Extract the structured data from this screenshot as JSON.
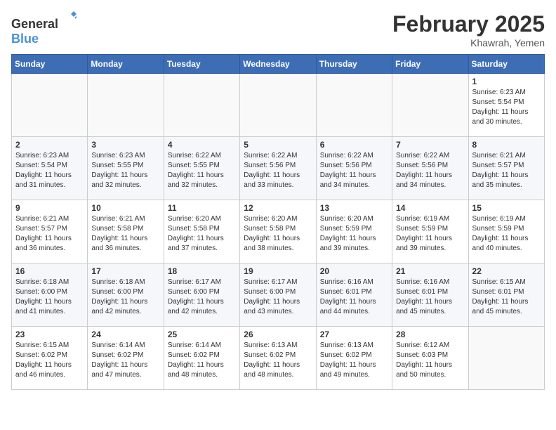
{
  "logo": {
    "text_general": "General",
    "text_blue": "Blue"
  },
  "title": "February 2025",
  "subtitle": "Khawrah, Yemen",
  "days_of_week": [
    "Sunday",
    "Monday",
    "Tuesday",
    "Wednesday",
    "Thursday",
    "Friday",
    "Saturday"
  ],
  "weeks": [
    [
      {
        "day": "",
        "info": ""
      },
      {
        "day": "",
        "info": ""
      },
      {
        "day": "",
        "info": ""
      },
      {
        "day": "",
        "info": ""
      },
      {
        "day": "",
        "info": ""
      },
      {
        "day": "",
        "info": ""
      },
      {
        "day": "1",
        "info": "Sunrise: 6:23 AM\nSunset: 5:54 PM\nDaylight: 11 hours and 30 minutes."
      }
    ],
    [
      {
        "day": "2",
        "info": "Sunrise: 6:23 AM\nSunset: 5:54 PM\nDaylight: 11 hours and 31 minutes."
      },
      {
        "day": "3",
        "info": "Sunrise: 6:23 AM\nSunset: 5:55 PM\nDaylight: 11 hours and 32 minutes."
      },
      {
        "day": "4",
        "info": "Sunrise: 6:22 AM\nSunset: 5:55 PM\nDaylight: 11 hours and 32 minutes."
      },
      {
        "day": "5",
        "info": "Sunrise: 6:22 AM\nSunset: 5:56 PM\nDaylight: 11 hours and 33 minutes."
      },
      {
        "day": "6",
        "info": "Sunrise: 6:22 AM\nSunset: 5:56 PM\nDaylight: 11 hours and 34 minutes."
      },
      {
        "day": "7",
        "info": "Sunrise: 6:22 AM\nSunset: 5:56 PM\nDaylight: 11 hours and 34 minutes."
      },
      {
        "day": "8",
        "info": "Sunrise: 6:21 AM\nSunset: 5:57 PM\nDaylight: 11 hours and 35 minutes."
      }
    ],
    [
      {
        "day": "9",
        "info": "Sunrise: 6:21 AM\nSunset: 5:57 PM\nDaylight: 11 hours and 36 minutes."
      },
      {
        "day": "10",
        "info": "Sunrise: 6:21 AM\nSunset: 5:58 PM\nDaylight: 11 hours and 36 minutes."
      },
      {
        "day": "11",
        "info": "Sunrise: 6:20 AM\nSunset: 5:58 PM\nDaylight: 11 hours and 37 minutes."
      },
      {
        "day": "12",
        "info": "Sunrise: 6:20 AM\nSunset: 5:58 PM\nDaylight: 11 hours and 38 minutes."
      },
      {
        "day": "13",
        "info": "Sunrise: 6:20 AM\nSunset: 5:59 PM\nDaylight: 11 hours and 39 minutes."
      },
      {
        "day": "14",
        "info": "Sunrise: 6:19 AM\nSunset: 5:59 PM\nDaylight: 11 hours and 39 minutes."
      },
      {
        "day": "15",
        "info": "Sunrise: 6:19 AM\nSunset: 5:59 PM\nDaylight: 11 hours and 40 minutes."
      }
    ],
    [
      {
        "day": "16",
        "info": "Sunrise: 6:18 AM\nSunset: 6:00 PM\nDaylight: 11 hours and 41 minutes."
      },
      {
        "day": "17",
        "info": "Sunrise: 6:18 AM\nSunset: 6:00 PM\nDaylight: 11 hours and 42 minutes."
      },
      {
        "day": "18",
        "info": "Sunrise: 6:17 AM\nSunset: 6:00 PM\nDaylight: 11 hours and 42 minutes."
      },
      {
        "day": "19",
        "info": "Sunrise: 6:17 AM\nSunset: 6:00 PM\nDaylight: 11 hours and 43 minutes."
      },
      {
        "day": "20",
        "info": "Sunrise: 6:16 AM\nSunset: 6:01 PM\nDaylight: 11 hours and 44 minutes."
      },
      {
        "day": "21",
        "info": "Sunrise: 6:16 AM\nSunset: 6:01 PM\nDaylight: 11 hours and 45 minutes."
      },
      {
        "day": "22",
        "info": "Sunrise: 6:15 AM\nSunset: 6:01 PM\nDaylight: 11 hours and 45 minutes."
      }
    ],
    [
      {
        "day": "23",
        "info": "Sunrise: 6:15 AM\nSunset: 6:02 PM\nDaylight: 11 hours and 46 minutes."
      },
      {
        "day": "24",
        "info": "Sunrise: 6:14 AM\nSunset: 6:02 PM\nDaylight: 11 hours and 47 minutes."
      },
      {
        "day": "25",
        "info": "Sunrise: 6:14 AM\nSunset: 6:02 PM\nDaylight: 11 hours and 48 minutes."
      },
      {
        "day": "26",
        "info": "Sunrise: 6:13 AM\nSunset: 6:02 PM\nDaylight: 11 hours and 48 minutes."
      },
      {
        "day": "27",
        "info": "Sunrise: 6:13 AM\nSunset: 6:02 PM\nDaylight: 11 hours and 49 minutes."
      },
      {
        "day": "28",
        "info": "Sunrise: 6:12 AM\nSunset: 6:03 PM\nDaylight: 11 hours and 50 minutes."
      },
      {
        "day": "",
        "info": ""
      }
    ]
  ]
}
